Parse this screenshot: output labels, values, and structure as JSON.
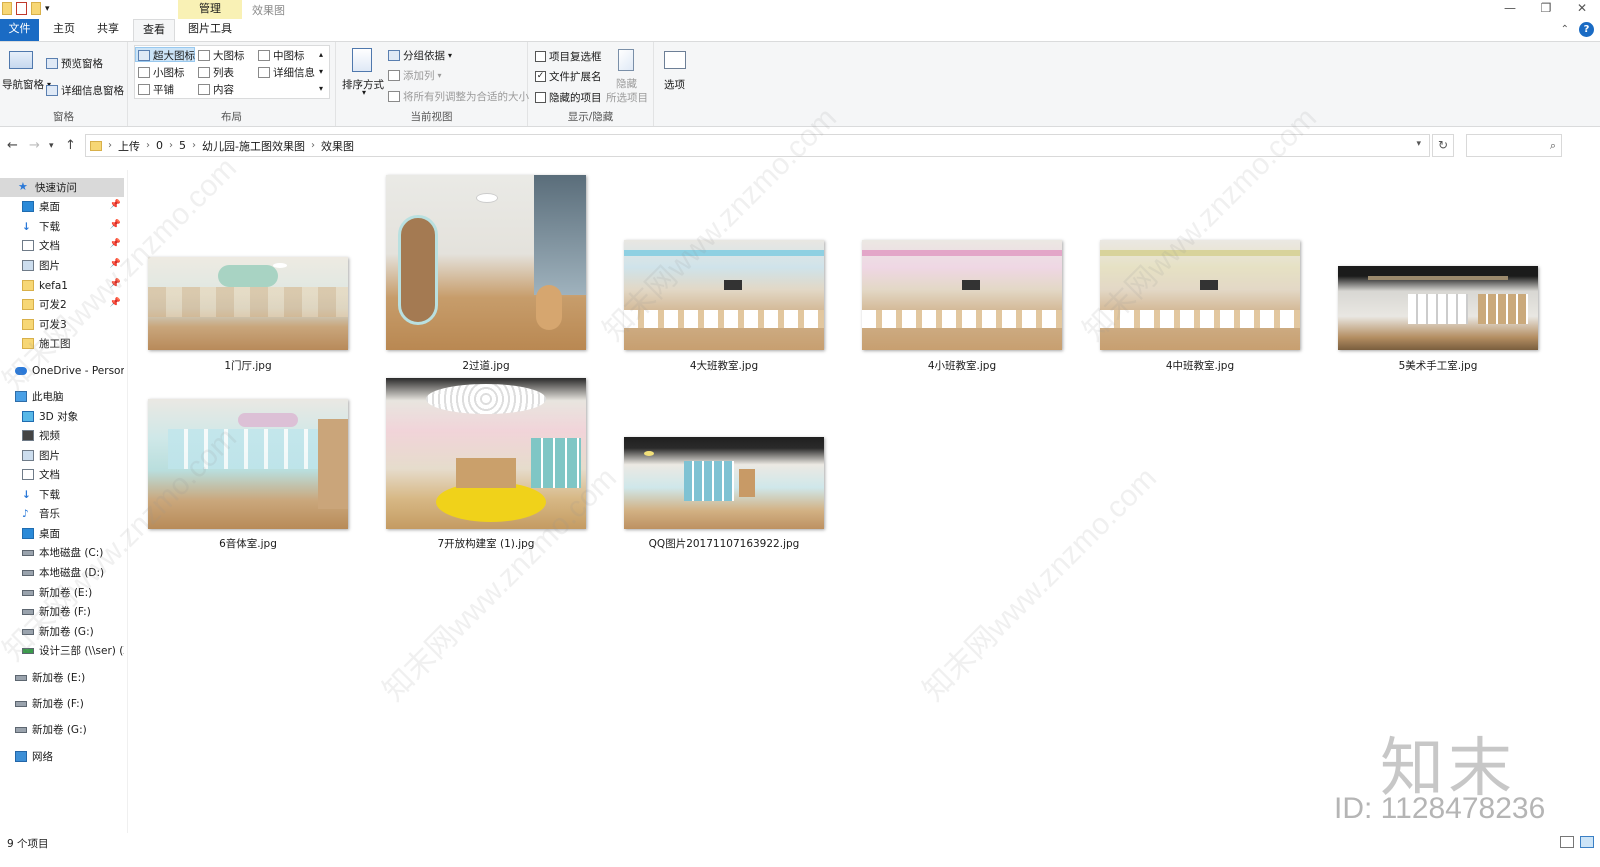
{
  "window": {
    "title": "效果图",
    "context_tab": "管理",
    "context_group": "图片工具"
  },
  "tabs": {
    "file": "文件",
    "home": "主页",
    "share": "共享",
    "view": "查看",
    "picture_tools": "图片工具"
  },
  "ribbon": {
    "panes": {
      "nav_pane": "导航窗格",
      "preview_pane": "预览窗格",
      "details_pane": "详细信息窗格",
      "label": "窗格"
    },
    "layout": {
      "extra_large": "超大图标",
      "large": "大图标",
      "medium": "中图标",
      "small": "小图标",
      "list": "列表",
      "details": "详细信息",
      "tiles": "平铺",
      "content": "内容",
      "label": "布局"
    },
    "current_view": {
      "sort_by": "排序方式",
      "group_by": "分组依据",
      "add_columns": "添加列",
      "size_all_columns": "将所有列调整为合适的大小",
      "label": "当前视图"
    },
    "show_hide": {
      "item_checkboxes": "项目复选框",
      "file_extensions": "文件扩展名",
      "hidden_items": "隐藏的项目",
      "hide_selected_1": "隐藏",
      "hide_selected_2": "所选项目",
      "label": "显示/隐藏",
      "item_checkboxes_checked": false,
      "file_extensions_checked": true,
      "hidden_items_checked": false
    },
    "options": "选项"
  },
  "address": {
    "crumbs": [
      "上传",
      "0",
      "5",
      "幼儿园-施工图效果图",
      "效果图"
    ]
  },
  "nav": {
    "quick_access": "快速访问",
    "quick_items": [
      "桌面",
      "下载",
      "文档",
      "图片",
      "kefa1",
      "可发2",
      "可发3",
      "施工图"
    ],
    "onedrive": "OneDrive - Persona",
    "this_pc": "此电脑",
    "pc_items": [
      "3D 对象",
      "视频",
      "图片",
      "文档",
      "下载",
      "音乐",
      "桌面",
      "本地磁盘 (C:)",
      "本地磁盘 (D:)",
      "新加卷 (E:)",
      "新加卷 (F:)",
      "新加卷 (G:)",
      "设计三部 (\\\\ser) (Z"
    ],
    "drives": [
      "新加卷 (E:)",
      "新加卷 (F:)",
      "新加卷 (G:)"
    ],
    "network": "网络"
  },
  "files": [
    {
      "name": "1门厅.jpg"
    },
    {
      "name": "2过道.jpg"
    },
    {
      "name": "4大班教室.jpg"
    },
    {
      "name": "4小班教室.jpg"
    },
    {
      "name": "4中班教室.jpg"
    },
    {
      "name": "5美术手工室.jpg"
    },
    {
      "name": "6音体室.jpg"
    },
    {
      "name": "7开放构建室 (1).jpg"
    },
    {
      "name": "QQ图片20171107163922.jpg"
    }
  ],
  "status": {
    "count": "9 个项目"
  },
  "watermark": {
    "logo": "知末",
    "id": "ID: 1128478236",
    "diag": "知末网www.znzmo.com"
  },
  "colors": {
    "accent": "#1a6bc4",
    "context_tab": "#f9f1b5",
    "selection": "#cce4f7"
  }
}
